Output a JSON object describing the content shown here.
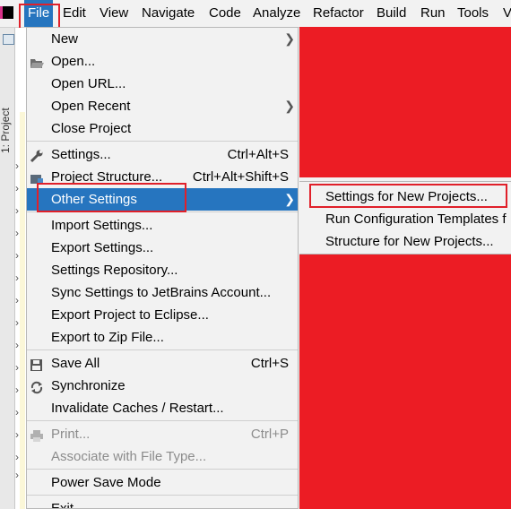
{
  "menubar": {
    "items": [
      "File",
      "Edit",
      "View",
      "Navigate",
      "Code",
      "Analyze",
      "Refactor",
      "Build",
      "Run",
      "Tools",
      "V"
    ]
  },
  "sidebar": {
    "project_tab": "1: Project"
  },
  "file_menu": {
    "items": [
      {
        "label": "New",
        "shortcut": "",
        "submenu": true
      },
      {
        "label": "Open...",
        "shortcut": "",
        "icon": "folder-open-icon"
      },
      {
        "label": "Open URL...",
        "shortcut": ""
      },
      {
        "label": "Open Recent",
        "shortcut": "",
        "submenu": true
      },
      {
        "label": "Close Project",
        "shortcut": ""
      },
      {
        "label": "Settings...",
        "shortcut": "Ctrl+Alt+S",
        "icon": "wrench-icon"
      },
      {
        "label": "Project Structure...",
        "shortcut": "Ctrl+Alt+Shift+S",
        "icon": "project-structure-icon"
      },
      {
        "label": "Other Settings",
        "shortcut": "",
        "submenu": true,
        "selected": true
      },
      {
        "label": "Import Settings...",
        "shortcut": ""
      },
      {
        "label": "Export Settings...",
        "shortcut": ""
      },
      {
        "label": "Settings Repository...",
        "shortcut": ""
      },
      {
        "label": "Sync Settings to JetBrains Account...",
        "shortcut": ""
      },
      {
        "label": "Export Project to Eclipse...",
        "shortcut": ""
      },
      {
        "label": "Export to Zip File...",
        "shortcut": ""
      },
      {
        "label": "Save All",
        "shortcut": "Ctrl+S",
        "icon": "save-icon"
      },
      {
        "label": "Synchronize",
        "shortcut": "",
        "icon": "sync-icon"
      },
      {
        "label": "Invalidate Caches / Restart...",
        "shortcut": ""
      },
      {
        "label": "Print...",
        "shortcut": "Ctrl+P",
        "icon": "print-icon",
        "disabled": true
      },
      {
        "label": "Associate with File Type...",
        "shortcut": "",
        "disabled": true
      },
      {
        "label": "Power Save Mode",
        "shortcut": ""
      },
      {
        "label": "Exit",
        "shortcut": ""
      }
    ]
  },
  "other_settings_submenu": {
    "items": [
      "Settings for New Projects...",
      "Run Configuration Templates f",
      "Structure for New Projects..."
    ]
  },
  "colors": {
    "selection": "#2675bf",
    "highlight_box": "#e0202a",
    "redaction": "#ec1c24"
  }
}
